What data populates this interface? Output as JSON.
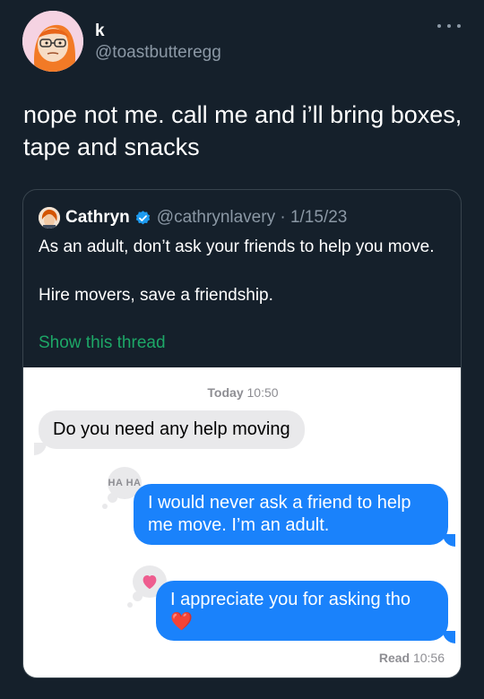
{
  "author": {
    "display_name": "k",
    "handle": "@toastbutteregg"
  },
  "tweet": {
    "text": "nope not me. call me and i’ll bring boxes, tape and snacks"
  },
  "quoted": {
    "name": "Cathryn",
    "handle_date": "@cathrynlavery · 1/15/23",
    "body": "As an adult, don’t ask your friends to help you move.\n\nHire movers, save a friendship.",
    "show_thread": "Show this thread",
    "verified_color": "#1d9bf0"
  },
  "chat": {
    "timestamp_day": "Today",
    "timestamp_time": "10:50",
    "messages": [
      {
        "text": "Do you need any help moving",
        "direction": "received"
      },
      {
        "text": "I would never ask a friend to help me move. I’m an adult.",
        "direction": "sent",
        "tapback": "HA HA"
      },
      {
        "text": "I appreciate you for asking tho",
        "direction": "sent",
        "tapback": "heart-icon",
        "emoji": "❤️"
      }
    ],
    "read_label": "Read",
    "read_time": "10:56",
    "sent_color": "#1a82fb",
    "received_color": "#e9e9eb"
  }
}
